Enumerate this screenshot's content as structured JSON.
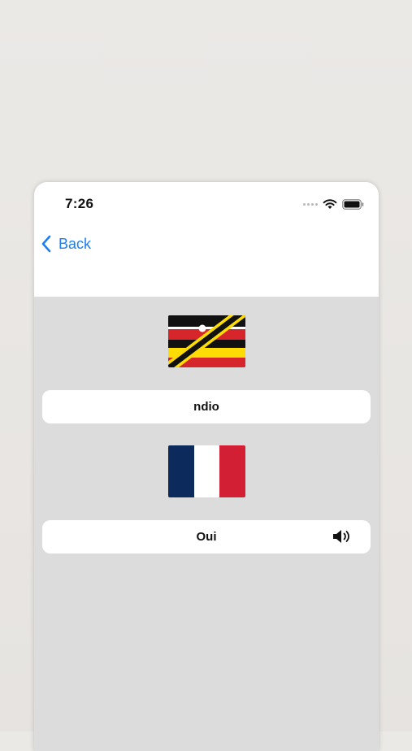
{
  "status_bar": {
    "time": "7:26"
  },
  "nav": {
    "back_label": "Back"
  },
  "cards": [
    {
      "flag": "swahili-flag",
      "word": "ndio"
    },
    {
      "flag": "french-flag",
      "word": "Oui",
      "audio_icon": "speaker-icon"
    }
  ],
  "colors": {
    "accent": "#1e7ef2",
    "background": "#dcdcdc",
    "card": "#ffffff"
  }
}
